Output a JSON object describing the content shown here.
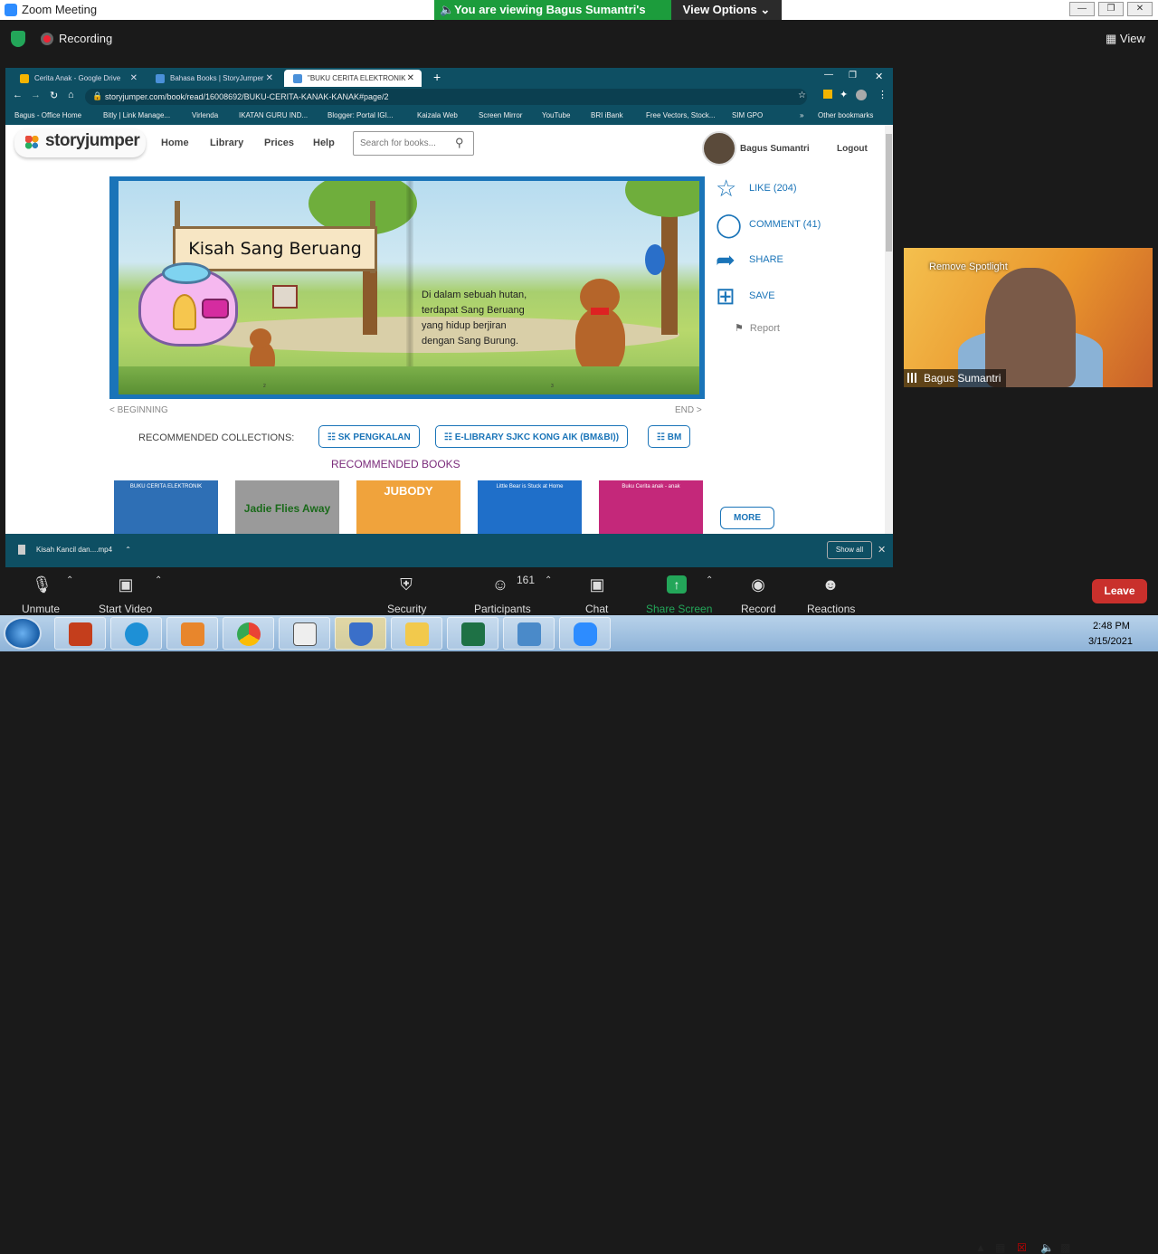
{
  "zoom": {
    "window_title": "Zoom Meeting",
    "share_banner": "You are viewing Bagus Sumantri's screen",
    "view_options": "View Options",
    "recording": "Recording",
    "view": "View",
    "toolbar": {
      "unmute": "Unmute",
      "start_video": "Start Video",
      "security": "Security",
      "participants": "Participants",
      "participants_count": "161",
      "chat": "Chat",
      "share_screen": "Share Screen",
      "record": "Record",
      "reactions": "Reactions",
      "leave": "Leave"
    },
    "video_tile": {
      "remove_spotlight": "Remove Spotlight",
      "name": "Bagus Sumantri"
    },
    "share_screen_color": "#23a659",
    "leave_color": "#c9302c"
  },
  "browser": {
    "tabs": [
      {
        "label": "Cerita Anak - Google Drive"
      },
      {
        "label": "Bahasa Books | StoryJumper"
      },
      {
        "label": "\"BUKU CERITA ELEKTRONIK"
      }
    ],
    "url": "storyjumper.com/book/read/16008692/BUKU-CERITA-KANAK-KANAK#page/2",
    "bookmarks": [
      "Bagus - Office Home",
      "Bitly | Link Manage...",
      "Virlenda",
      "IKATAN GURU IND...",
      "Blogger: Portal IGI...",
      "Kaizala Web",
      "Screen Mirror",
      "YouTube",
      "BRI iBank",
      "Free Vectors, Stock...",
      "SIM GPO",
      "»",
      "Other bookmarks"
    ],
    "download_file": "Kisah Kancil dan....mp4",
    "show_all": "Show all"
  },
  "site": {
    "logo": "storyjumper",
    "nav": [
      "Home",
      "Library",
      "Prices",
      "Help"
    ],
    "search_placeholder": "Search for books...",
    "username": "Bagus Sumantri",
    "logout": "Logout",
    "book": {
      "title": "Kisah Sang Beruang",
      "text": "Di dalam sebuah hutan, terdapat Sang Beruang yang hidup berjiran dengan Sang Burung.",
      "page_left": "2",
      "page_right": "3"
    },
    "actions": {
      "like": "LIKE (204)",
      "comment": "COMMENT (41)",
      "share": "SHARE",
      "save": "SAVE",
      "report": "Report"
    },
    "beginning": "< BEGINNING",
    "end": "END >",
    "recommended_collections_label": "RECOMMENDED COLLECTIONS:",
    "collections": [
      "SK PENGKALAN",
      "E-LIBRARY SJKC KONG AIK (BM&BI))",
      "BM"
    ],
    "recommended_books_title": "RECOMMENDED BOOKS",
    "books": [
      {
        "title": "BUKU CERITA ELEKTRONIK",
        "color": "#2e6fb5"
      },
      {
        "title": "Jadie Flies Away",
        "color": "#9a9a9a"
      },
      {
        "title": "JUBODY",
        "color": "#f0a33c"
      },
      {
        "title": "Little Bear is Stuck at Home",
        "color": "#1f6fc9"
      },
      {
        "title": "Buku Cerita anak - anak",
        "color": "#c4287a"
      }
    ],
    "more": "MORE",
    "accent_color": "#1a74b8"
  },
  "taskbar": {
    "time": "2:48 PM",
    "date": "3/15/2021"
  }
}
